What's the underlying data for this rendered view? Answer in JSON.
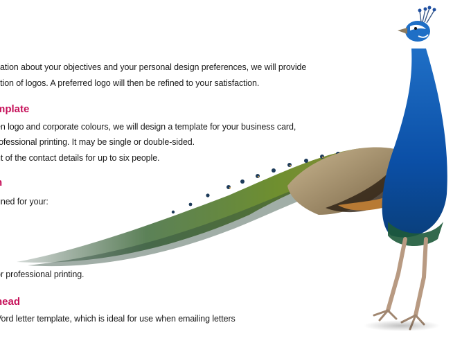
{
  "intro": {
    "line1": "ltation about your objectives and your personal design preferences, we will provide",
    "line2": "ction of logos. A preferred logo will then be refined to your satisfaction."
  },
  "section_template": {
    "heading": "mplate",
    "line1": "en logo and corporate colours, we will design a template for your business card,",
    "line2": "rofessional printing.  It may be single or double-sided.",
    "line3": "ut of the contact details for up to six people."
  },
  "section_design": {
    "heading": "n",
    "line1": "gned for your:",
    "line2": "or professional printing."
  },
  "section_letterhead": {
    "heading": "head",
    "line1": "Vord letter template, which is ideal for use when emailing letters"
  },
  "image": {
    "subject": "peacock-illustration"
  }
}
